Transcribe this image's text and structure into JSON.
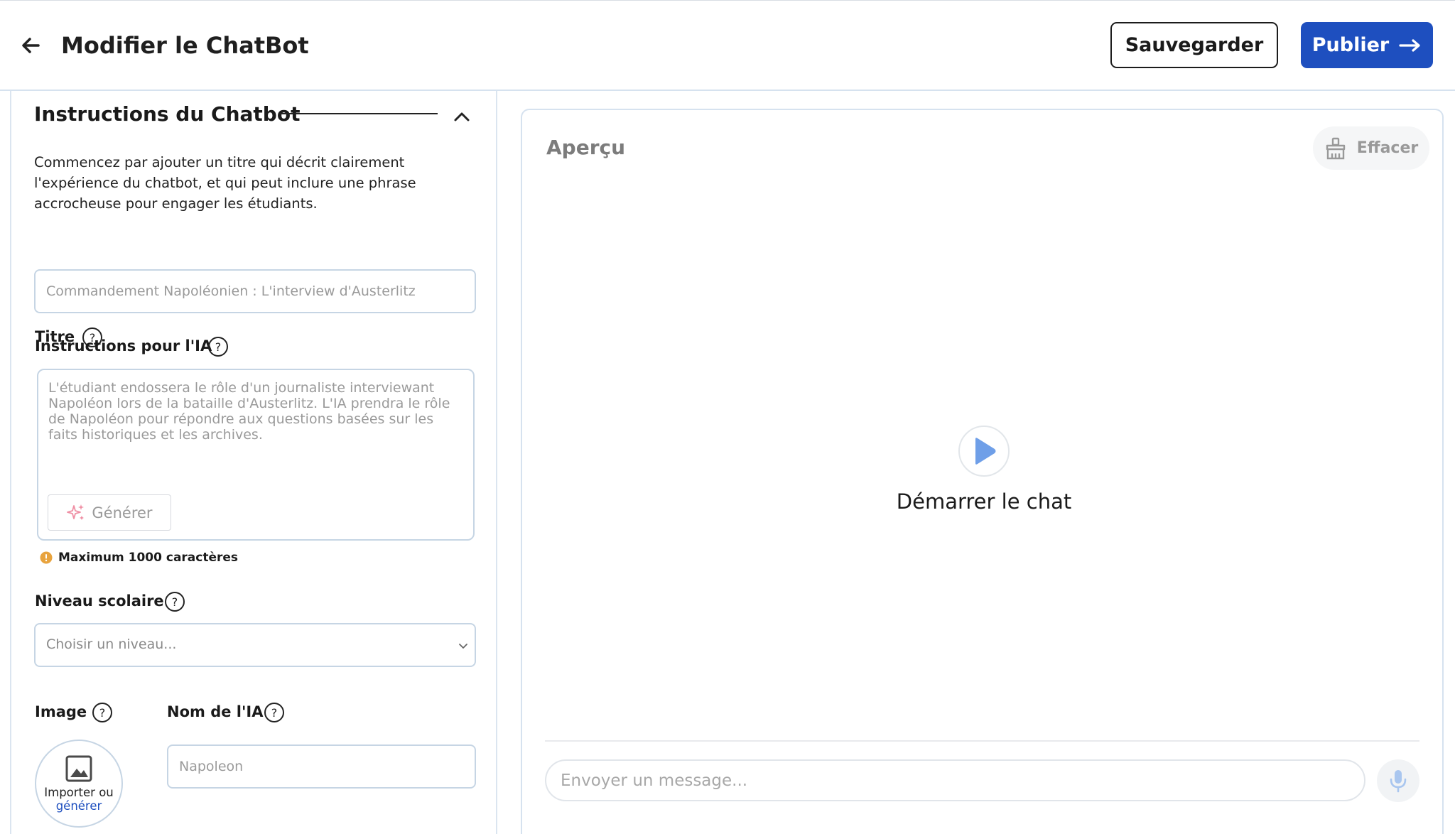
{
  "header": {
    "title": "Modifier le ChatBot",
    "save_label": "Sauvegarder",
    "publish_label": "Publier"
  },
  "instructions": {
    "section_title": "Instructions du Chatbot",
    "intro": "Commencez par ajouter un titre qui décrit clairement l'expérience du chatbot, et qui peut inclure une phrase accrocheuse pour engager les étudiants.",
    "title_label": "Titre",
    "title_placeholder": "Commandement Napoléonien : L'interview d'Austerlitz",
    "ai_instructions_label": "Instructions pour l'IA",
    "ai_instructions_placeholder": "L'étudiant endossera le rôle d'un journaliste interviewant Napoléon lors de la bataille d'Austerlitz. L'IA prendra le rôle de Napoléon pour répondre aux questions basées sur les faits historiques et les archives.",
    "generate_label": "Générer",
    "max_chars_note": "Maximum 1000 caractères",
    "level_label": "Niveau scolaire",
    "level_value": "Choisir un niveau...",
    "image_label": "Image",
    "image_upload_line1": "Importer ou",
    "image_upload_line2": "générer",
    "ai_name_label": "Nom de l'IA",
    "ai_name_placeholder": "Napoleon"
  },
  "preview": {
    "title": "Aperçu",
    "clear_label": "Effacer",
    "start_chat_label": "Démarrer le chat",
    "message_placeholder": "Envoyer un message..."
  },
  "colors": {
    "accent": "#1e4fbf",
    "border": "#c6d5e4",
    "play": "#6f9fe8",
    "warning": "#e8a33d",
    "sparkle": "#ef8fa4"
  },
  "icons": [
    "arrow-left-icon",
    "arrow-right-icon",
    "chevron-up-icon",
    "help-circle-icon",
    "sparkle-icon",
    "alert-icon",
    "chevron-down-icon",
    "image-icon",
    "broom-icon",
    "play-icon",
    "microphone-icon"
  ]
}
